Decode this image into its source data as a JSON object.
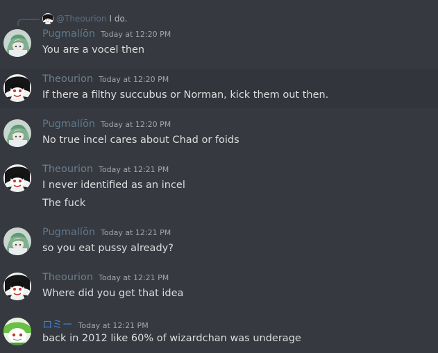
{
  "reply": {
    "username": "@Theourion",
    "text": "I do."
  },
  "colors": {
    "background": "#36393f",
    "pugmalion_name": "#5f7a8c",
    "theourion_name": "#6c7e8d",
    "romi_name": "#3b83d6"
  },
  "messages": [
    {
      "username": "Pugmalíōn",
      "timestamp": "Today at 12:20 PM",
      "lines": [
        "You are a vocel then"
      ],
      "avatar": "pugmalion-avatar"
    },
    {
      "username": "Theourion",
      "timestamp": "Today at 12:20 PM",
      "lines": [
        "If there a filthy succubus or Norman, kick them out then."
      ],
      "avatar": "theourion-avatar"
    },
    {
      "username": "Pugmalíōn",
      "timestamp": "Today at 12:20 PM",
      "lines": [
        "No true incel cares about Chad or foids"
      ],
      "avatar": "pugmalion-avatar"
    },
    {
      "username": "Theourion",
      "timestamp": "Today at 12:21 PM",
      "lines": [
        "I never identified as an incel",
        "The fuck"
      ],
      "avatar": "theourion-avatar"
    },
    {
      "username": "Pugmalíōn",
      "timestamp": "Today at 12:21 PM",
      "lines": [
        "so you eat pussy already?"
      ],
      "avatar": "pugmalion-avatar"
    },
    {
      "username": "Theourion",
      "timestamp": "Today at 12:21 PM",
      "lines": [
        "Where did you get that idea"
      ],
      "avatar": "theourion-avatar"
    },
    {
      "username": "ロミー",
      "timestamp": "Today at 12:21 PM",
      "lines": [
        "back in 2012 like 60% of wizardchan was underage"
      ],
      "avatar": "romi-avatar"
    }
  ]
}
